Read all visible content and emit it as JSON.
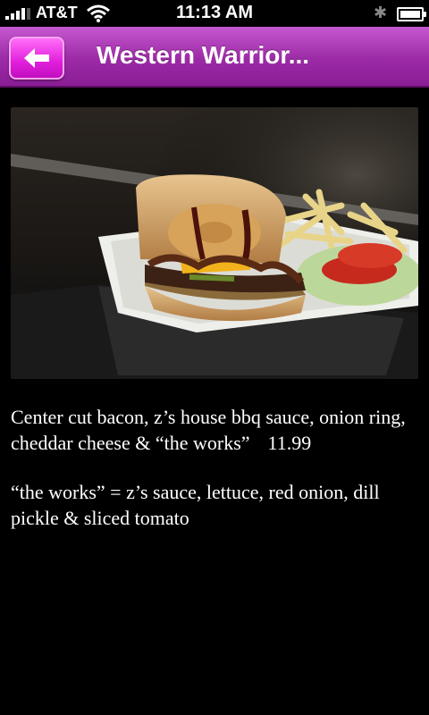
{
  "status_bar": {
    "carrier": "AT&T",
    "time": "11:13 AM",
    "signal_bars": 4,
    "battery_level": 0.85
  },
  "header": {
    "title": "Western Warrior...",
    "back_icon": "arrow-left-icon"
  },
  "item": {
    "description": "Center cut bacon, z’s house bbq sauce, onion ring, cheddar cheese & “the works”",
    "price": "11.99",
    "note": "“the works” = z’s sauce, lettuce, red onion, dill pickle & sliced tomato"
  },
  "colors": {
    "header": "#9c2aa6",
    "back_button": "#e21fdc",
    "background": "#000000"
  }
}
